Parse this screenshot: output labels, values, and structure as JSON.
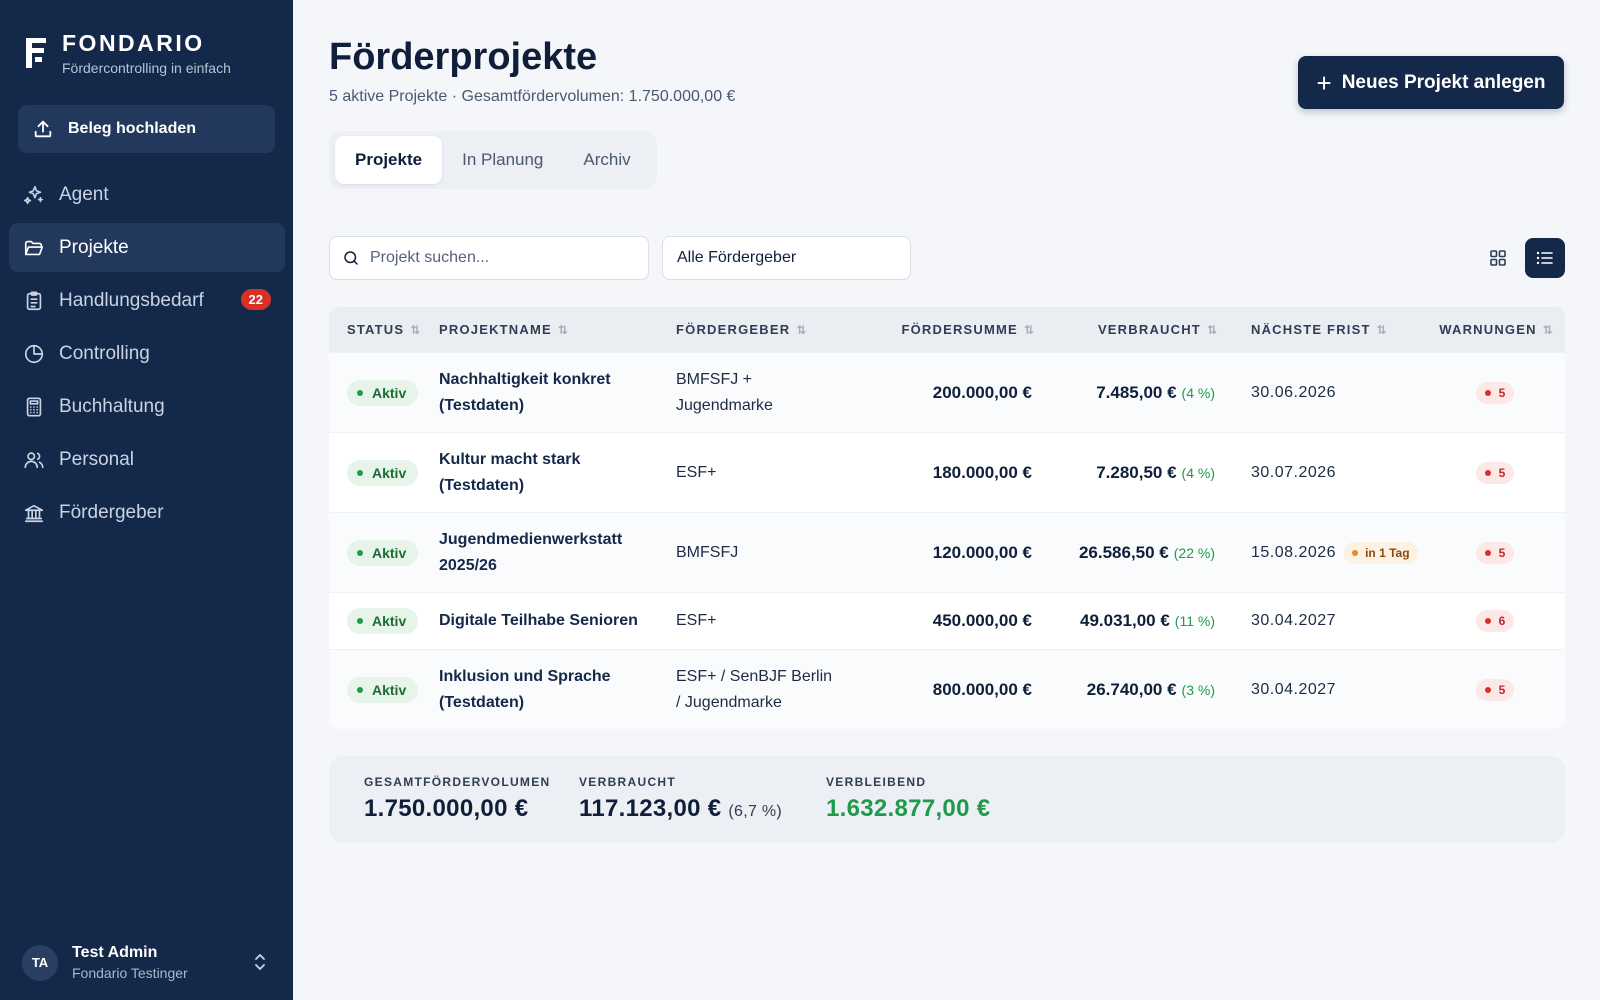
{
  "brand": {
    "name": "FONDARIO",
    "tagline": "Fördercontrolling in einfach"
  },
  "sidebar": {
    "upload_label": "Beleg hochladen",
    "items": [
      {
        "label": "Agent",
        "icon": "sparkles-icon"
      },
      {
        "label": "Projekte",
        "icon": "folder-open-icon",
        "active": true
      },
      {
        "label": "Handlungsbedarf",
        "icon": "clipboard-list-icon",
        "badge": "22"
      },
      {
        "label": "Controlling",
        "icon": "pie-chart-icon"
      },
      {
        "label": "Buchhaltung",
        "icon": "calculator-icon"
      },
      {
        "label": "Personal",
        "icon": "users-icon"
      },
      {
        "label": "Fördergeber",
        "icon": "bank-icon"
      }
    ]
  },
  "user": {
    "initials": "TA",
    "name": "Test Admin",
    "org": "Fondario Testinger"
  },
  "header": {
    "title": "Förderprojekte",
    "subtitle": "5 aktive Projekte · Gesamtfördervolumen: 1.750.000,00 €",
    "new_button": "Neues Projekt anlegen"
  },
  "tabs": [
    "Projekte",
    "In Planung",
    "Archiv"
  ],
  "filters": {
    "search_placeholder": "Projekt suchen...",
    "funder_selected": "Alle Fördergeber"
  },
  "table": {
    "columns": [
      "STATUS",
      "PROJEKTNAME",
      "FÖRDERGEBER",
      "FÖRDERSUMME",
      "VERBRAUCHT",
      "NÄCHSTE FRIST",
      "WARNUNGEN"
    ],
    "sort_glyph": "⇅",
    "rows": [
      {
        "status": "Aktiv",
        "name_l1": "Nachhaltigkeit konkret",
        "name_l2": "(Testdaten)",
        "geber_l1": "BMFSFJ +",
        "geber_l2": "Jugendmarke",
        "summe": "200.000,00 €",
        "verbraucht": "7.485,00 €",
        "pct": "(4 %)",
        "frist": "30.06.2026",
        "frist_badge": "",
        "warnungen": "5"
      },
      {
        "status": "Aktiv",
        "name_l1": "Kultur macht stark",
        "name_l2": "(Testdaten)",
        "geber_l1": "ESF+",
        "geber_l2": "",
        "summe": "180.000,00 €",
        "verbraucht": "7.280,50 €",
        "pct": "(4 %)",
        "frist": "30.07.2026",
        "frist_badge": "",
        "warnungen": "5"
      },
      {
        "status": "Aktiv",
        "name_l1": "Jugendmedienwerkstatt",
        "name_l2": "2025/26",
        "geber_l1": "BMFSFJ",
        "geber_l2": "",
        "summe": "120.000,00 €",
        "verbraucht": "26.586,50 €",
        "pct": "(22 %)",
        "frist": "15.08.2026",
        "frist_badge": "in 1 Tag",
        "warnungen": "5"
      },
      {
        "status": "Aktiv",
        "name_l1": "Digitale Teilhabe Senioren",
        "name_l2": "",
        "geber_l1": "ESF+",
        "geber_l2": "",
        "summe": "450.000,00 €",
        "verbraucht": "49.031,00 €",
        "pct": "(11 %)",
        "frist": "30.04.2027",
        "frist_badge": "",
        "warnungen": "6"
      },
      {
        "status": "Aktiv",
        "name_l1": "Inklusion und Sprache",
        "name_l2": "(Testdaten)",
        "geber_l1": "ESF+ / SenBJF Berlin",
        "geber_l2": "/ Jugendmarke",
        "summe": "800.000,00 €",
        "verbraucht": "26.740,00 €",
        "pct": "(3 %)",
        "frist": "30.04.2027",
        "frist_badge": "",
        "warnungen": "5"
      }
    ]
  },
  "summary": {
    "total_label": "GESAMTFÖRDERVOLUMEN",
    "total_value": "1.750.000,00 €",
    "used_label": "VERBRAUCHT",
    "used_value": "117.123,00 €",
    "used_pct": "(6,7 %)",
    "remaining_label": "VERBLEIBEND",
    "remaining_value": "1.632.877,00 €"
  },
  "colors": {
    "sidebar_bg": "#14284a",
    "accent": "#14284a",
    "success": "#1f9a4b",
    "danger": "#d93025",
    "warning": "#e58b1f"
  }
}
